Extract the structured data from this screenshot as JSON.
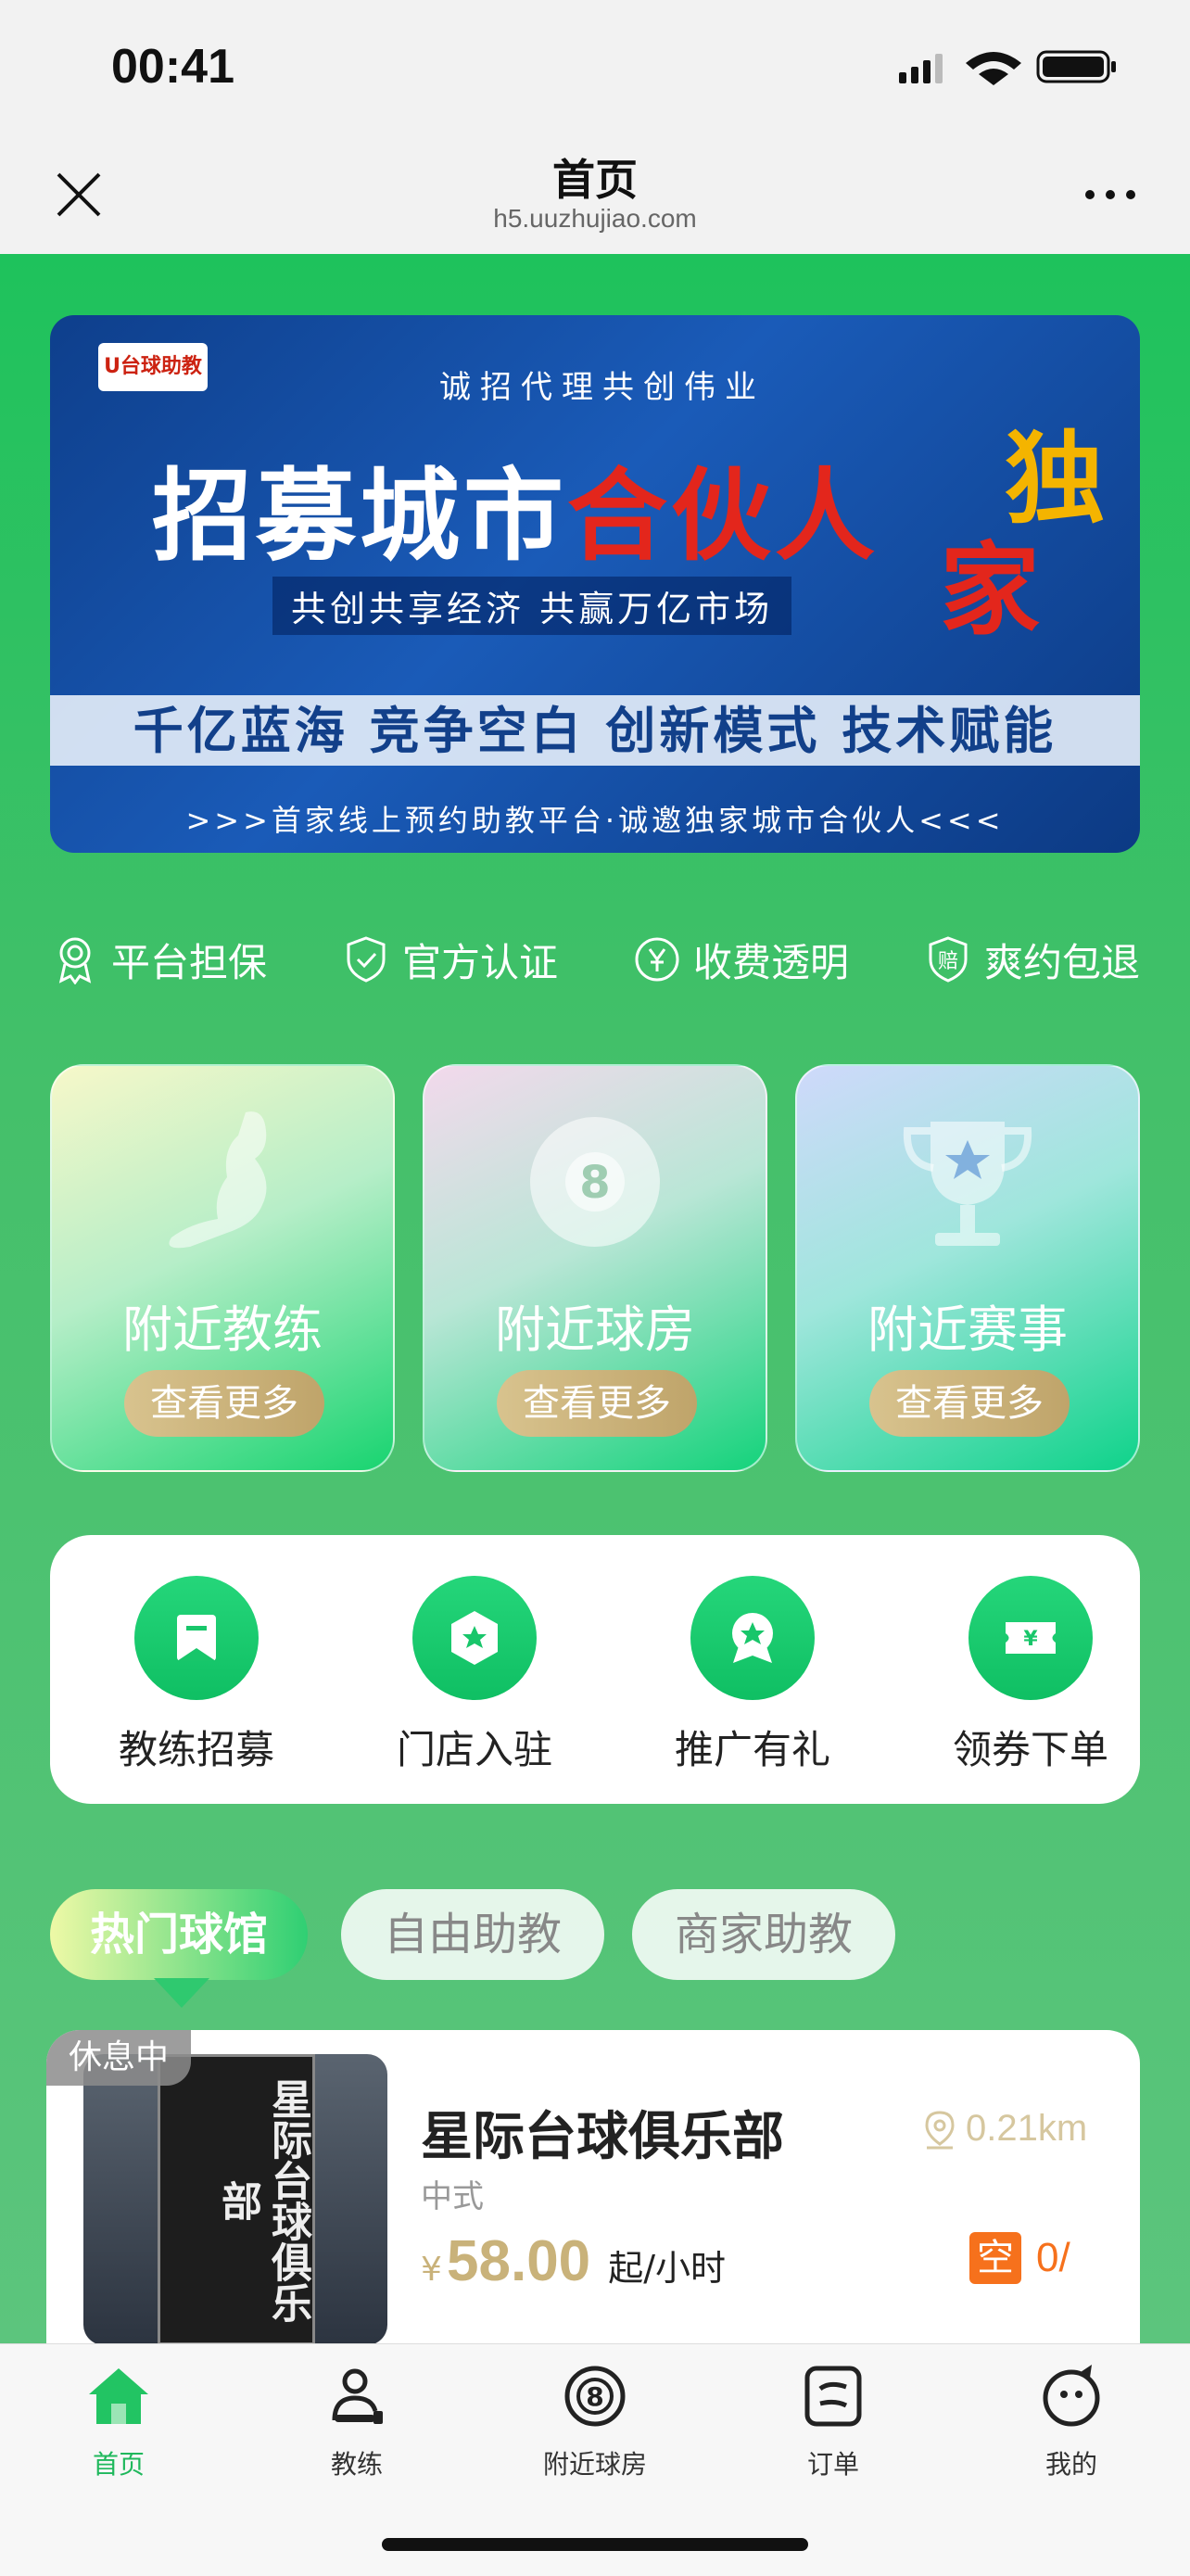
{
  "status_bar": {
    "time": "00:41"
  },
  "navbar": {
    "title": "首页",
    "url": "h5.uuzhujiao.com"
  },
  "banner": {
    "logo_text": "U台球助教",
    "top_line": "诚招代理共创伟业",
    "headline_white": "招募城市",
    "headline_red": "合伙人",
    "side_yellow": "独",
    "side_red": "家",
    "subline": "共创共享经济 共赢万亿市场",
    "strip": "千亿蓝海 竞争空白 创新模式 技术赋能",
    "bottom": ">>>首家线上预约助教平台·诚邀独家城市合伙人<<<"
  },
  "features": [
    {
      "label": "平台担保",
      "icon": "award-icon"
    },
    {
      "label": "官方认证",
      "icon": "shield-check-icon"
    },
    {
      "label": "收费透明",
      "icon": "yen-circle-icon"
    },
    {
      "label": "爽约包退",
      "icon": "refund-shield-icon"
    }
  ],
  "cards": [
    {
      "title": "附近教练",
      "button": "查看更多",
      "icon": "coach-silhouette-icon"
    },
    {
      "title": "附近球房",
      "button": "查看更多",
      "icon": "eight-ball-icon"
    },
    {
      "title": "附近赛事",
      "button": "查看更多",
      "icon": "trophy-icon"
    }
  ],
  "services": [
    {
      "label": "教练招募",
      "icon": "recruit-icon"
    },
    {
      "label": "门店入驻",
      "icon": "store-icon"
    },
    {
      "label": "推广有礼",
      "icon": "badge-icon"
    },
    {
      "label": "领券下单",
      "icon": "coupon-icon"
    }
  ],
  "tabs": [
    {
      "label": "热门球馆",
      "active": true
    },
    {
      "label": "自由助教",
      "active": false
    },
    {
      "label": "商家助教",
      "active": false
    }
  ],
  "venue": {
    "status": "休息中",
    "name": "星际台球俱乐部",
    "distance": "0.21km",
    "type": "中式",
    "currency": "¥",
    "price": "58.00",
    "price_unit": "起/小时",
    "empty_badge": "空",
    "empty_count": "0/",
    "sign_text": "星际台球俱乐部"
  },
  "tabbar": [
    {
      "label": "首页",
      "active": true,
      "icon": "home-icon"
    },
    {
      "label": "教练",
      "active": false,
      "icon": "coach-icon"
    },
    {
      "label": "附近球房",
      "active": false,
      "icon": "eight-ball-icon"
    },
    {
      "label": "订单",
      "active": false,
      "icon": "order-icon"
    },
    {
      "label": "我的",
      "active": false,
      "icon": "profile-icon"
    }
  ],
  "colors": {
    "primary_green": "#1ec25c",
    "gold": "#c9b27a",
    "orange": "#f6711c"
  }
}
